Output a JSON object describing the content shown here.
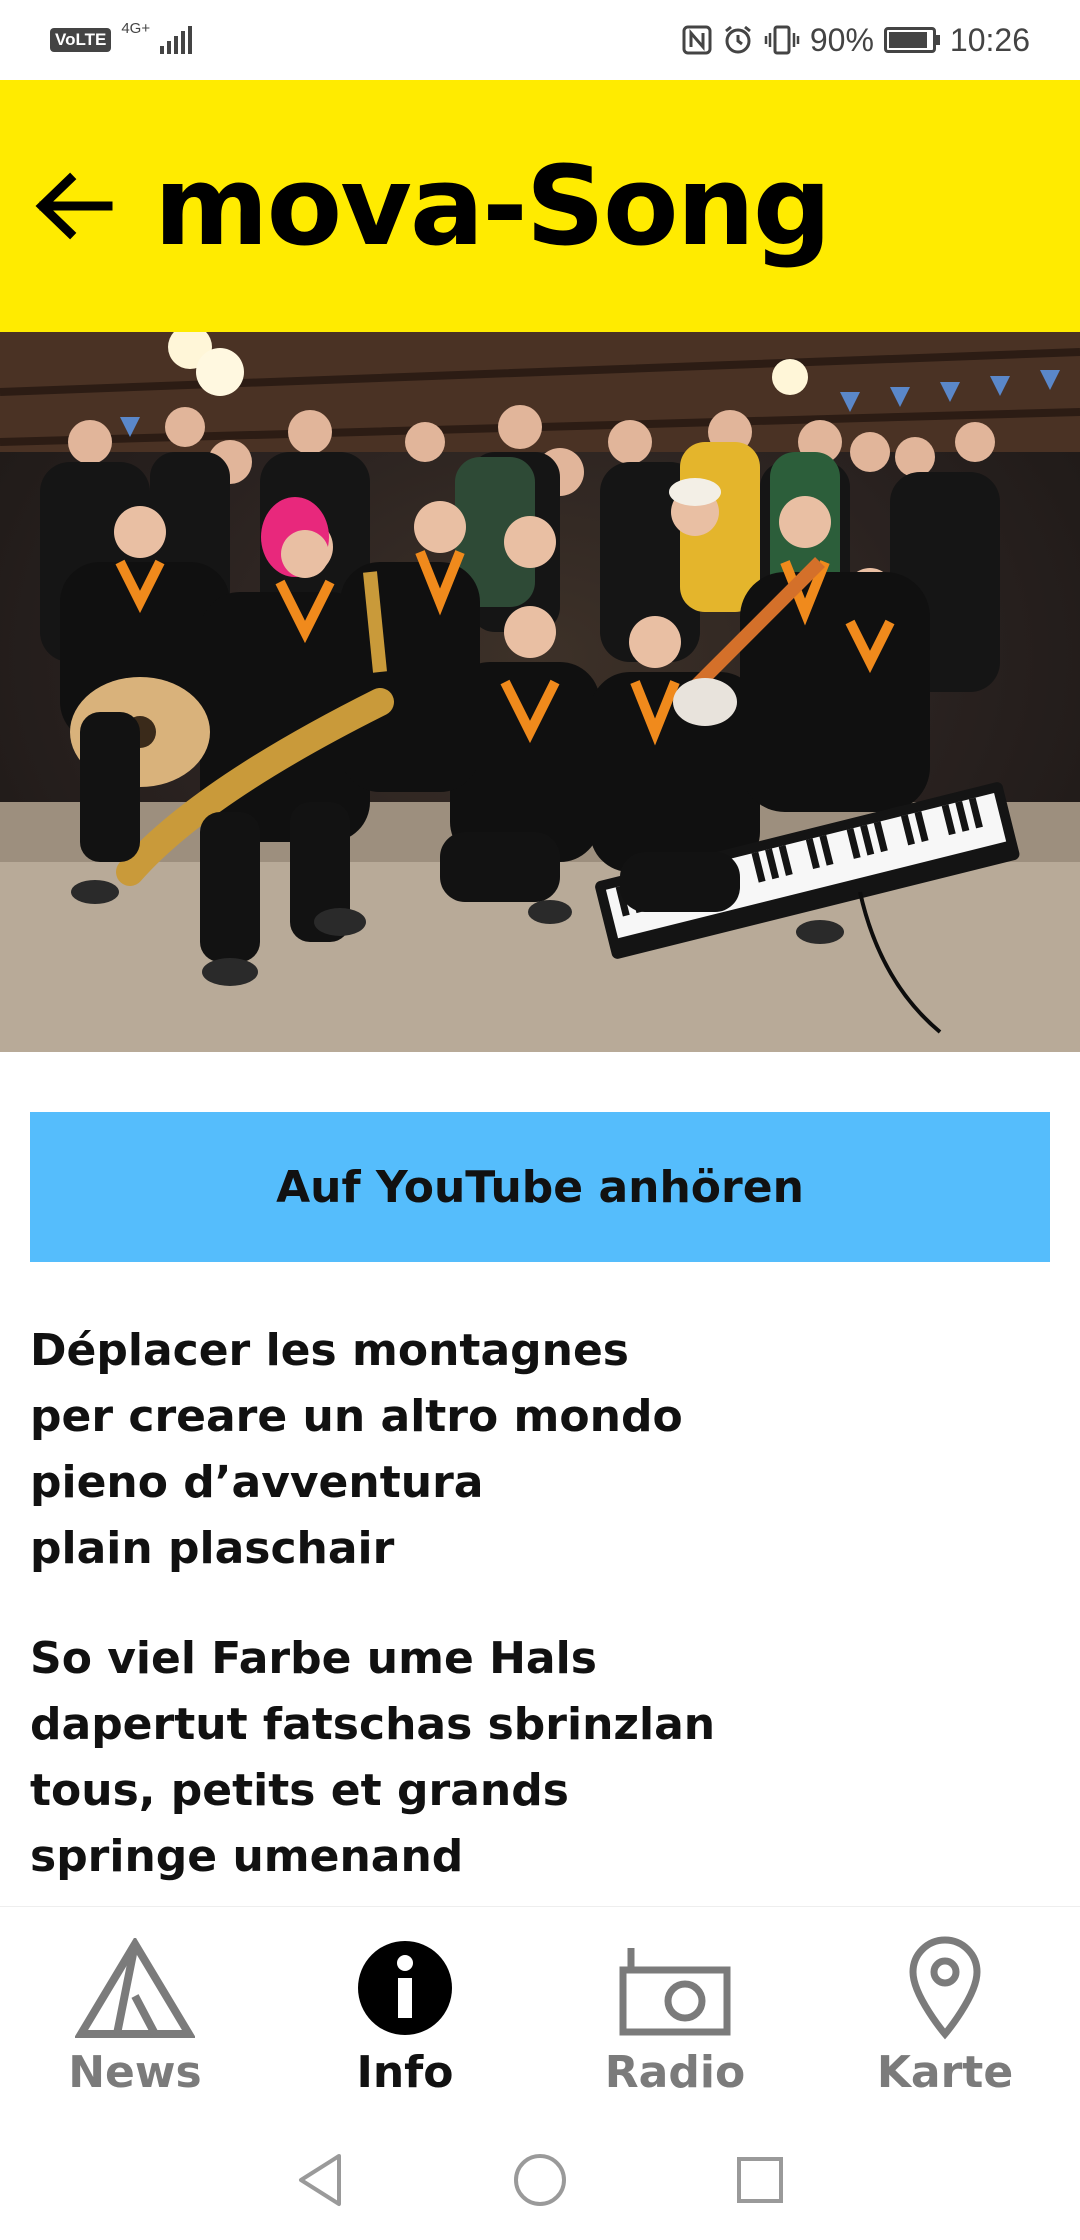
{
  "status_bar": {
    "volte": "VoLTE",
    "network": "4G+",
    "battery_percent": "90%",
    "battery_level": 0.9,
    "time": "10:26",
    "icons": [
      "nfc-icon",
      "alarm-icon",
      "vibrate-icon",
      "battery-icon"
    ]
  },
  "header": {
    "title": "mova-Song",
    "back_icon": "arrow-left-icon",
    "background": "#ffeb00"
  },
  "hero": {
    "description_icon": "band-photo"
  },
  "youtube_button": {
    "label": "Auf YouTube anhören",
    "color": "#55bdfc"
  },
  "lyrics": {
    "stanzas": [
      [
        "Déplacer les montagnes",
        "per creare un altro mondo",
        "pieno d’avventura",
        "plain plaschair"
      ],
      [
        "So viel Farbe ume Hals",
        "dapertut fatschas sbrinzlan",
        "tous, petits et grands",
        "springe umenand"
      ]
    ]
  },
  "bottom_nav": {
    "items": [
      {
        "label": "News",
        "icon": "tent-icon",
        "active": false
      },
      {
        "label": "Info",
        "icon": "info-icon",
        "active": true
      },
      {
        "label": "Radio",
        "icon": "radio-icon",
        "active": false
      },
      {
        "label": "Karte",
        "icon": "map-pin-icon",
        "active": false
      }
    ],
    "active_color": "#111111",
    "inactive_color": "#7b7b7b"
  },
  "system_nav": {
    "buttons": [
      "back-triangle-icon",
      "home-circle-icon",
      "recents-square-icon"
    ]
  }
}
